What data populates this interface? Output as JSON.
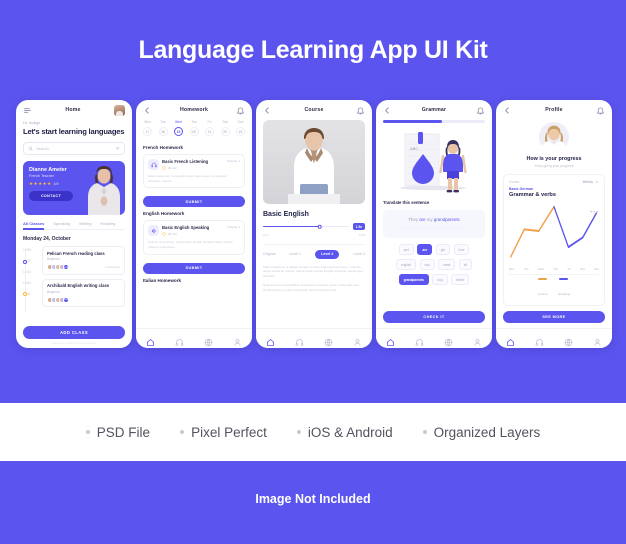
{
  "page": {
    "title": "Language Learning App UI Kit",
    "footer_note": "Image Not Included",
    "brand_color": "#5B54EE",
    "accent_orange": "#FFB930"
  },
  "features": [
    {
      "label": "PSD File"
    },
    {
      "label": "Pixel Perfect"
    },
    {
      "label": "iOS & Android"
    },
    {
      "label": "Organized Layers"
    }
  ],
  "bottom_nav": [
    {
      "icon": "home-icon",
      "active": true
    },
    {
      "icon": "headphones-icon",
      "active": false
    },
    {
      "icon": "globe-icon",
      "active": false
    },
    {
      "icon": "person-icon",
      "active": false
    }
  ],
  "screens": {
    "home": {
      "title": "Home",
      "menu_icon": "hamburger-icon",
      "avatar": "user-avatar",
      "greeting": "Hi, Indigo",
      "heading": "Let's start learning languages",
      "search_placeholder": "Search",
      "search_icon": "search-icon",
      "filter_icon": "filter-icon",
      "teacher": {
        "name": "Dianne Ameter",
        "role": "French Teacher",
        "rating": "4.9",
        "stars": 5,
        "contact_label": "CONTACT"
      },
      "tabs": [
        {
          "label": "All Classes",
          "active": true
        },
        {
          "label": "Speaking",
          "active": false
        },
        {
          "label": "Writing",
          "active": false
        },
        {
          "label": "Reading",
          "active": false
        }
      ],
      "date_label": "Monday 24, October",
      "times": [
        "10:00",
        "11:00",
        "12:00",
        "13:00",
        "14:00"
      ],
      "classes": [
        {
          "title": "Pelican French reading class",
          "level": "Beginner",
          "meta": "4 Attendees",
          "extra": "+12"
        },
        {
          "title": "Archibald English writing class",
          "level": "Beginner",
          "meta": "4 Attendees",
          "extra": "+12"
        }
      ],
      "add_button": "ADD CLASS",
      "fine_print": "Lorem ipsum dolor sit amet consectetur"
    },
    "homework": {
      "title": "Homework",
      "back_icon": "arrow-left-icon",
      "bell_icon": "bell-icon",
      "days": [
        {
          "name": "Mon",
          "num": "17",
          "active": false
        },
        {
          "name": "Tue",
          "num": "18",
          "active": false
        },
        {
          "name": "Wed",
          "num": "19",
          "active": true
        },
        {
          "name": "Thu",
          "num": "20",
          "active": false
        },
        {
          "name": "Fri",
          "num": "21",
          "active": false
        },
        {
          "name": "Sat",
          "num": "22",
          "active": false
        },
        {
          "name": "Sun",
          "num": "23",
          "active": false
        }
      ],
      "sections": [
        {
          "title": "French Homework",
          "lesson": "Basic French Listening",
          "chapter": "Chapter 4",
          "duration": "30 min",
          "icon": "headphones-icon",
          "description": "Etiam metus est, consectetur eget neque eget, consectetur bibendum mauris.",
          "submit_label": "SUBMIT"
        },
        {
          "title": "English Homework",
          "lesson": "Basic English Speaking",
          "chapter": "Chapter 3",
          "duration": "30 min",
          "icon": "speaker-icon",
          "description": "Duis ac urna tortum, ornare dolor iaculis. Hendrerit ante. Ornare tristique turpis lacus.",
          "submit_label": "SUBMIT"
        }
      ],
      "third_section_title": "Italian Homework"
    },
    "course": {
      "title": "Course",
      "back_icon": "arrow-left-icon",
      "bell_icon": "bell-icon",
      "video_alt": "course-video",
      "course_title": "Basic English",
      "speed": "1.5x",
      "progress_percent": 66,
      "time_current": "3:17",
      "time_total": "5:44",
      "levels": [
        {
          "label": "Original",
          "active": false
        },
        {
          "label": "Level 1",
          "active": false
        },
        {
          "label": "Level 2",
          "active": true
        },
        {
          "label": "Level 3",
          "active": false
        }
      ],
      "paragraphs": [
        "Etiam fringilla ex ut aliquet tempus. Fusce porta euismod metus, in lacinia augue luctus ac. Integer mauris ligula, lacinia fringilla vulputate mauris eget pharetra.",
        "Nulla sit amet lectus finibus, imperdiet in egestas metus. Nulla nulla sem, condimentum et purus consequat, cursus maximus nisi."
      ]
    },
    "grammar": {
      "title": "Grammar",
      "back_icon": "arrow-left-icon",
      "bell_icon": "bell-icon",
      "progress_percent": 58,
      "illustration": "study-illustration",
      "question": "Translate this sentence",
      "sentence_prefix": "They ",
      "sentence_word1": "are",
      "sentence_middle": " my ",
      "sentence_word2": "grandparents",
      "answer_dashes": "........................................",
      "word_chips": [
        [
          {
            "label": "and",
            "selected": false
          },
          {
            "label": "are",
            "selected": true
          },
          {
            "label": "girl",
            "selected": false
          },
          {
            "label": "how",
            "selected": false
          }
        ],
        [
          {
            "label": "english",
            "selected": false
          },
          {
            "label": "boy",
            "selected": false
          },
          {
            "label": "meet",
            "selected": false
          },
          {
            "label": "sit",
            "selected": false
          }
        ],
        [
          {
            "label": "grandparents",
            "selected": true
          },
          {
            "label": "dog",
            "selected": false
          },
          {
            "label": "father",
            "selected": false
          }
        ]
      ],
      "check_label": "CHECK IT"
    },
    "profile": {
      "title": "Profile",
      "back_icon": "arrow-left-icon",
      "bell_icon": "bell-icon",
      "avatar": "profile-avatar",
      "heading": "How is your progress",
      "subheading": "Keep going your progress",
      "course_label": "Course",
      "period": "Weekly",
      "period_icon": "chevron-down-icon",
      "course_name": "Basic German",
      "topic": "Grammar & verbs",
      "see_more_label": "SEE MORE"
    }
  },
  "chart_data": {
    "type": "line",
    "title": "Grammar & verbs",
    "categories": [
      "Mon",
      "Tue",
      "Wed",
      "Thu",
      "Fri",
      "Sat",
      "Sun"
    ],
    "series": [
      {
        "name": "Course",
        "color": "#EFA24E",
        "values": [
          18,
          52,
          50,
          86,
          null,
          null,
          null
        ]
      },
      {
        "name": "Speaking",
        "color": "#5B54EE",
        "values": [
          null,
          null,
          null,
          86,
          30,
          44,
          74
        ]
      }
    ],
    "ylim": [
      0,
      100
    ],
    "grid": false,
    "legend_position": "bottom",
    "xlabel": "",
    "ylabel": ""
  }
}
